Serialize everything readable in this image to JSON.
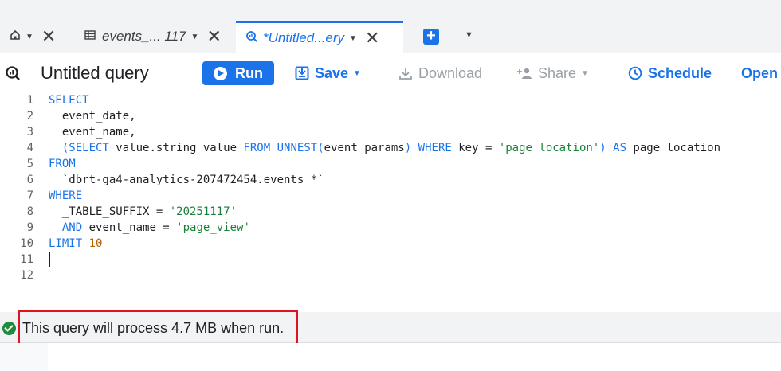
{
  "tabs": {
    "events_label": "events_... 117",
    "active_label": "*Untitled...ery"
  },
  "toolbar": {
    "title": "Untitled query",
    "run_label": "Run",
    "save_label": "Save",
    "download_label": "Download",
    "share_label": "Share",
    "schedule_label": "Schedule",
    "open_label": "Open"
  },
  "editor": {
    "line_numbers": [
      "1",
      "2",
      "3",
      "4",
      "5",
      "6",
      "7",
      "8",
      "9",
      "10",
      "11",
      "12"
    ],
    "lines": [
      "SELECT",
      "  event_date,",
      "  event_name,",
      "  (SELECT value.string_value FROM UNNEST(event_params) WHERE key = 'page_location') AS page_location",
      "FROM",
      "  `dbrt-ga4-analytics-207472454.events_*`",
      "WHERE",
      "  _TABLE_SUFFIX = '20251117'",
      "  AND event_name = 'page_view'",
      "LIMIT 10",
      "",
      ""
    ]
  },
  "status": {
    "message": "This query will process 4.7 MB when run."
  },
  "colors": {
    "accent": "#1a73e8",
    "success": "#1e8e3e",
    "highlight": "#e0141e"
  }
}
